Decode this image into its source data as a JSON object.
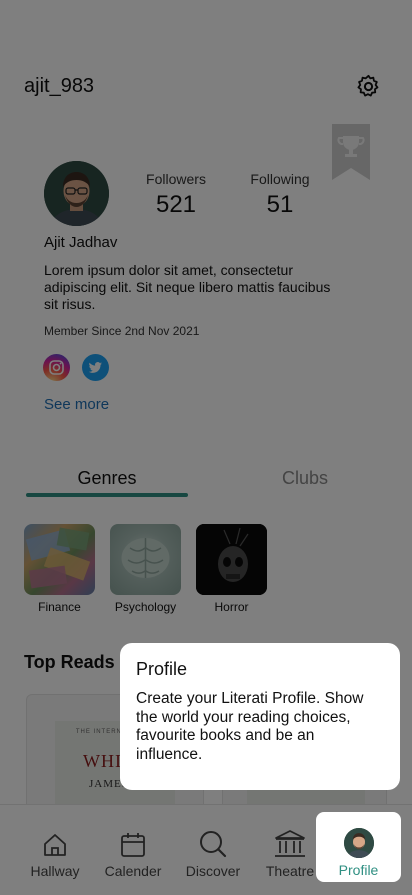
{
  "header": {
    "username": "ajit_983"
  },
  "profile": {
    "followers_label": "Followers",
    "followers_count": "521",
    "following_label": "Following",
    "following_count": "51",
    "name": "Ajit Jadhav",
    "bio": "Lorem ipsum dolor sit amet, consectetur adipiscing elit. Sit neque libero mattis faucibus sit risus.",
    "member_since": "Member Since 2nd Nov 2021",
    "see_more": "See more"
  },
  "tabs": [
    {
      "label": "Genres",
      "active": true
    },
    {
      "label": "Clubs",
      "active": false
    }
  ],
  "genres": [
    {
      "name": "Finance"
    },
    {
      "name": "Psychology"
    },
    {
      "name": "Horror"
    }
  ],
  "top_reads": {
    "heading": "Top Reads",
    "books": [
      {
        "cover_small": "THE INTERNATIONAL",
        "cover_title": "WHIRL",
        "cover_author": "JAMES C"
      }
    ]
  },
  "bottom_nav": [
    {
      "label": "Hallway",
      "icon": "home-icon"
    },
    {
      "label": "Calender",
      "icon": "calendar-icon"
    },
    {
      "label": "Discover",
      "icon": "search-icon"
    },
    {
      "label": "Theatre",
      "icon": "theatre-icon"
    },
    {
      "label": "Profile",
      "icon": "avatar",
      "active": true
    }
  ],
  "tooltip": {
    "title": "Profile",
    "body": "Create your Literati Profile. Show the world your reading choices, favourite books and be an influence."
  },
  "colors": {
    "accent": "#2f8f82",
    "link": "#1f6fb5",
    "overlay": "rgba(0,0,0,0.5)"
  }
}
